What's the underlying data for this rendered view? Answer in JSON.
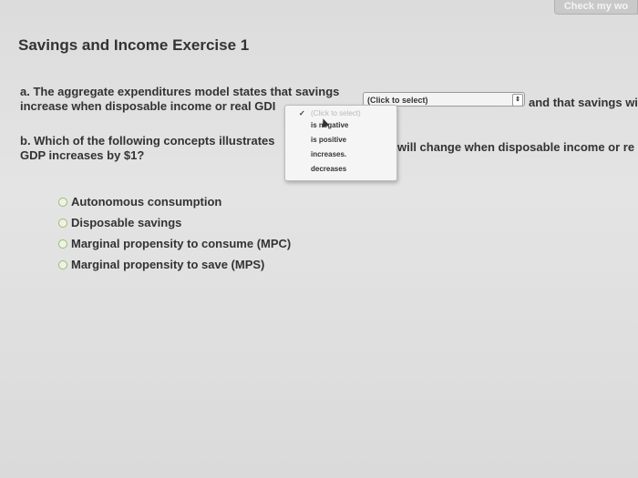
{
  "header": {
    "check_button": "Check my wo"
  },
  "title": "Savings and Income Exercise 1",
  "question_a": {
    "line1": "a. The aggregate expenditures model states that savings",
    "line2": "increase when disposable income or real GDI",
    "tail": "and that savings wil",
    "select_value": "(Click to select)"
  },
  "dropdown": {
    "selected": "(Click to select)",
    "options": [
      "is negative",
      "is positive",
      "increases.",
      "decreases"
    ]
  },
  "question_b": {
    "line1": "b. Which of the following concepts illustrates",
    "line2": "GDP increases by $1?",
    "tail": "will change when disposable income or re"
  },
  "options": [
    "Autonomous consumption",
    "Disposable savings",
    "Marginal propensity to consume (MPC)",
    "Marginal propensity to save (MPS)"
  ]
}
